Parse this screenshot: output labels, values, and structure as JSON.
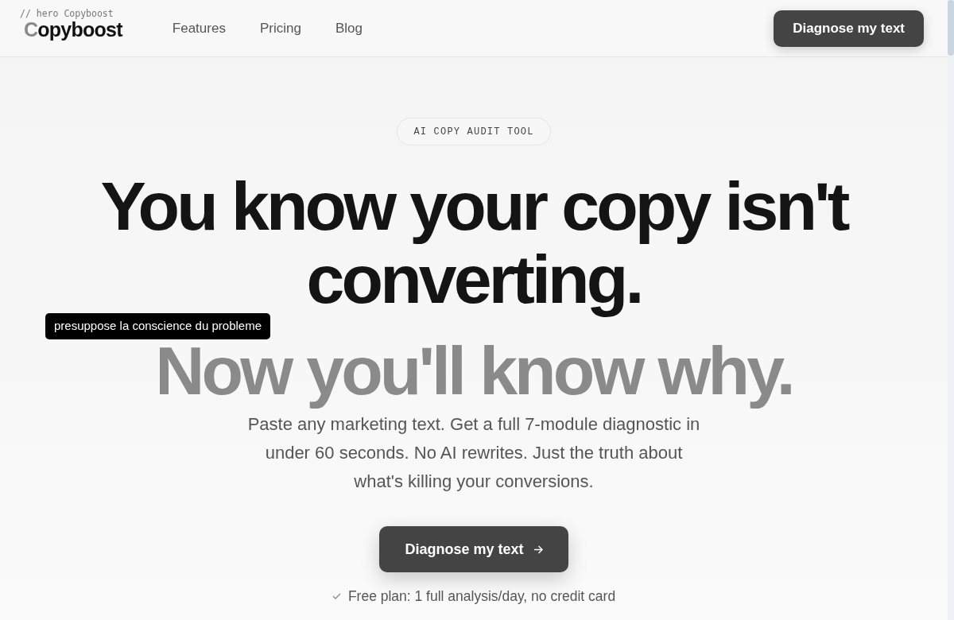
{
  "dev_label": "// hero Copyboost",
  "nav": {
    "logo": {
      "accent": "C",
      "rest": "opyboost"
    },
    "links": [
      "Features",
      "Pricing",
      "Blog"
    ],
    "cta": "Diagnose my text"
  },
  "hero": {
    "badge": "AI COPY AUDIT TOOL",
    "headline": [
      {
        "text": "You know your copy isn't converting.",
        "muted": false
      },
      {
        "text": "Now you'll know why.",
        "muted": true
      }
    ],
    "subtitle": "Paste any marketing text. Get a full 7-module diagnostic in under 60 seconds. No AI rewrites. Just the truth about what's killing your conversions.",
    "cta": "Diagnose my text",
    "note": "Free plan: 1 full analysis/day, no credit card"
  },
  "tooltip": {
    "text": "presuppose la conscience du probleme"
  }
}
